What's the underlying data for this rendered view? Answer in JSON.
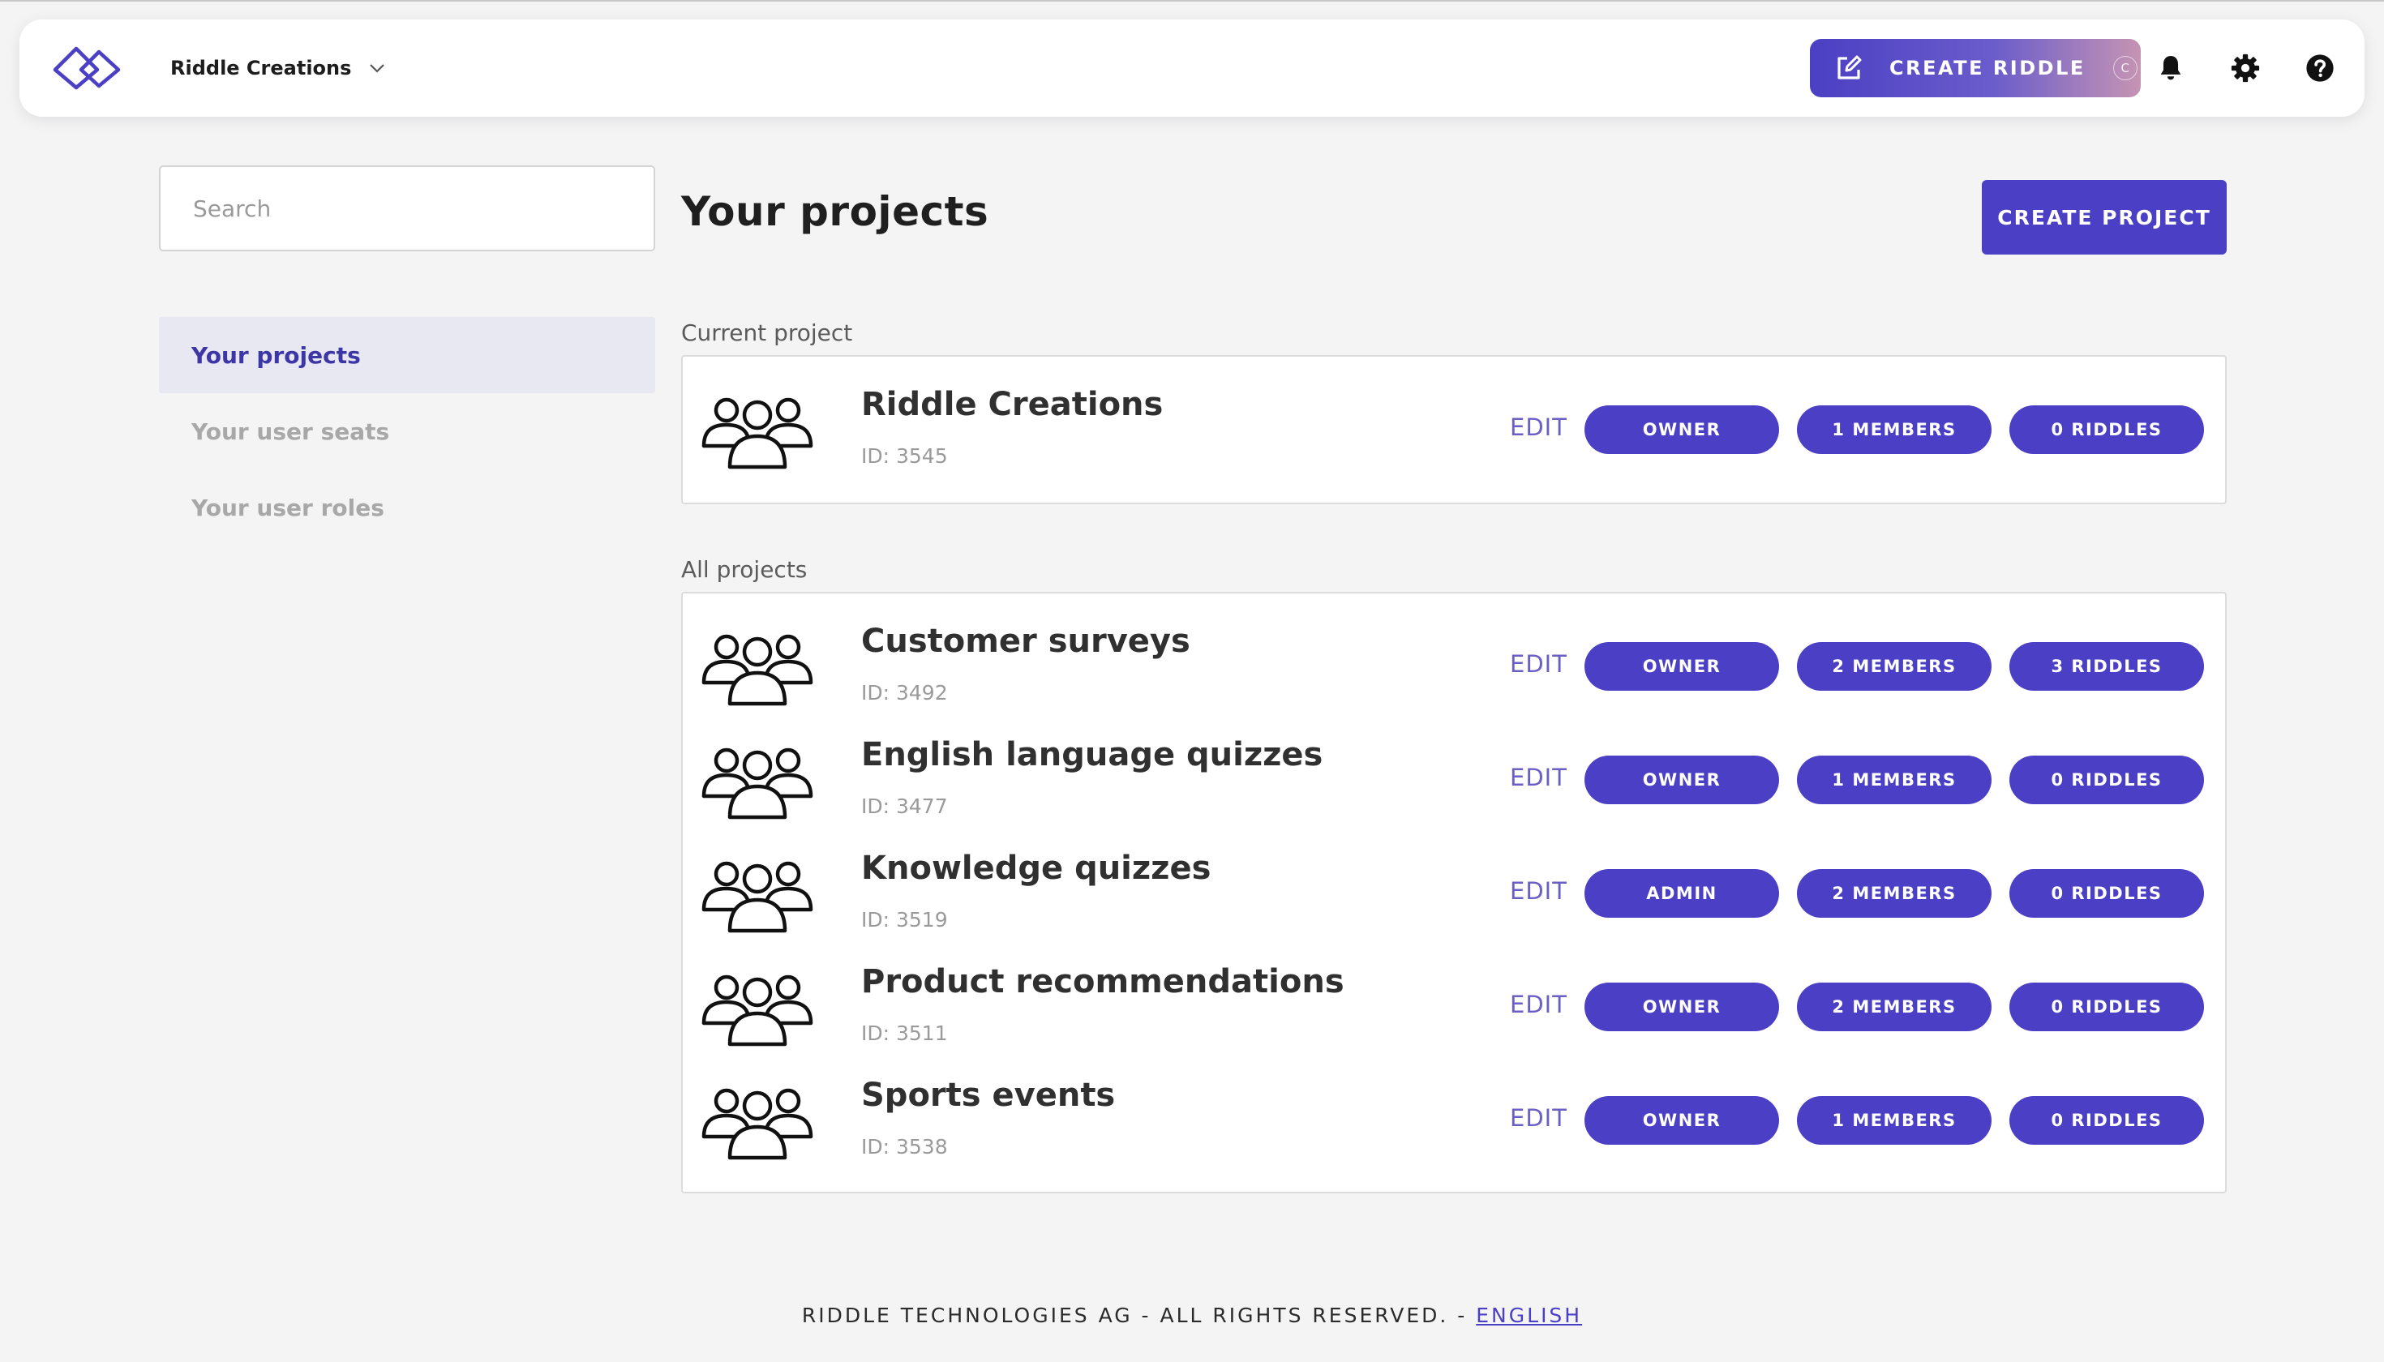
{
  "header": {
    "project_name": "Riddle Creations",
    "create_riddle_label": "CREATE RIDDLE",
    "create_riddle_shortcut": "C"
  },
  "sidebar": {
    "search_placeholder": "Search",
    "items": [
      {
        "label": "Your projects",
        "active": true
      },
      {
        "label": "Your user seats",
        "active": false
      },
      {
        "label": "Your user roles",
        "active": false
      }
    ]
  },
  "main": {
    "title": "Your projects",
    "create_project_label": "CREATE PROJECT",
    "edit_label": "EDIT",
    "current_label": "Current project",
    "all_label": "All projects",
    "current_project": {
      "name": "Riddle Creations",
      "id": "ID: 3545",
      "role": "OWNER",
      "members": "1 MEMBERS",
      "riddles": "0 RIDDLES"
    },
    "projects": [
      {
        "name": "Customer surveys",
        "id": "ID: 3492",
        "role": "OWNER",
        "members": "2 MEMBERS",
        "riddles": "3 RIDDLES"
      },
      {
        "name": "English language quizzes",
        "id": "ID: 3477",
        "role": "OWNER",
        "members": "1 MEMBERS",
        "riddles": "0 RIDDLES"
      },
      {
        "name": "Knowledge quizzes",
        "id": "ID: 3519",
        "role": "ADMIN",
        "members": "2 MEMBERS",
        "riddles": "0 RIDDLES"
      },
      {
        "name": "Product recommendations",
        "id": "ID: 3511",
        "role": "OWNER",
        "members": "2 MEMBERS",
        "riddles": "0 RIDDLES"
      },
      {
        "name": "Sports events",
        "id": "ID: 3538",
        "role": "OWNER",
        "members": "1 MEMBERS",
        "riddles": "0 RIDDLES"
      }
    ]
  },
  "footer": {
    "text": "RIDDLE TECHNOLOGIES AG - ALL RIGHTS RESERVED. - ",
    "language_link": "ENGLISH"
  },
  "colors": {
    "accent": "#4a3fc5",
    "active_nav_bg": "#e8e8f2",
    "background": "#f4f4f5"
  },
  "icons": {
    "logo": "riddle-logo",
    "create_riddle": "edit-square-icon",
    "notifications": "bell-icon",
    "settings": "gear-icon",
    "help": "help-circle-icon",
    "project": "people-group-icon"
  }
}
